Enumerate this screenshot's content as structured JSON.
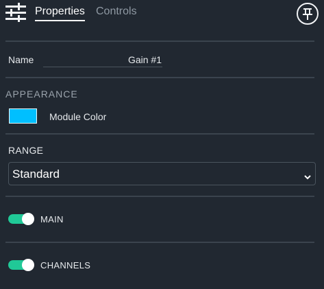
{
  "header": {
    "tabs": [
      {
        "label": "Properties",
        "active": true
      },
      {
        "label": "Controls",
        "active": false
      }
    ],
    "icons": {
      "menu": "sliders-icon",
      "pin": "pin-icon"
    }
  },
  "name": {
    "label": "Name",
    "value": "Gain #1"
  },
  "appearance": {
    "heading": "APPEARANCE",
    "module_color_label": "Module Color",
    "module_color": "#00BFFF"
  },
  "range": {
    "label": "RANGE",
    "selected": "Standard"
  },
  "toggles": [
    {
      "label": "MAIN",
      "on": true
    },
    {
      "label": "CHANNELS",
      "on": true
    }
  ],
  "colors": {
    "background": "#212831",
    "accent_toggle": "#20C997",
    "divider": "#3B444E"
  }
}
